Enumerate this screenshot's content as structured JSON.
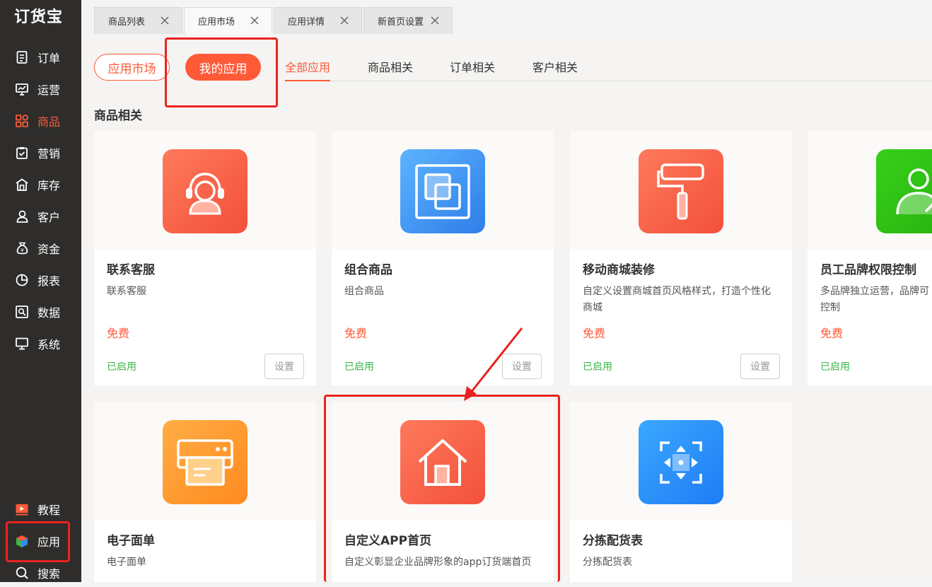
{
  "sidebar": {
    "logo": "订货宝",
    "items": [
      {
        "label": "订单",
        "icon": "order-doc-icon"
      },
      {
        "label": "运营",
        "icon": "chart-board-icon"
      },
      {
        "label": "商品",
        "icon": "grid-squares-icon"
      },
      {
        "label": "营销",
        "icon": "clipboard-check-icon"
      },
      {
        "label": "库存",
        "icon": "warehouse-icon"
      },
      {
        "label": "客户",
        "icon": "user-icon"
      },
      {
        "label": "资金",
        "icon": "money-bag-icon"
      },
      {
        "label": "报表",
        "icon": "pie-chart-icon"
      },
      {
        "label": "数据",
        "icon": "data-search-icon"
      },
      {
        "label": "系统",
        "icon": "monitor-icon"
      }
    ],
    "bottom_items": [
      {
        "label": "教程",
        "icon": "video-play-icon"
      },
      {
        "label": "应用",
        "icon": "cube-icon"
      },
      {
        "label": "搜索",
        "icon": "search-icon"
      }
    ]
  },
  "tabs": [
    {
      "label": "商品列表"
    },
    {
      "label": "应用市场"
    },
    {
      "label": "应用详情"
    },
    {
      "label": "新首页设置"
    }
  ],
  "header": {
    "market_label": "应用市场",
    "my_apps_label": "我的应用"
  },
  "subtabs": [
    "全部应用",
    "商品相关",
    "订单相关",
    "客户相关"
  ],
  "section_title": "商品相关",
  "cards": [
    {
      "name": "联系客服",
      "desc": "联系客服",
      "price": "免费",
      "status": "已启用",
      "button": "设置",
      "icon": "customer-service-icon"
    },
    {
      "name": "组合商品",
      "desc": "组合商品",
      "price": "免费",
      "status": "已启用",
      "button": "设置",
      "icon": "combine-squares-icon"
    },
    {
      "name": "移动商城装修",
      "desc": "自定义设置商城首页风格样式，打造个性化商城",
      "price": "免费",
      "status": "已启用",
      "button": "设置",
      "icon": "paint-roller-icon"
    },
    {
      "name": "员工品牌权限控制",
      "desc": "多品牌独立运营，品牌可控制",
      "price": "免费",
      "status": "已启用",
      "icon": "user-permission-icon"
    },
    {
      "name": "电子面单",
      "desc": "电子面单",
      "icon": "printer-icon"
    },
    {
      "name": "自定义APP首页",
      "desc": "自定义彰显企业品牌形象的app订货端首页",
      "icon": "home-icon"
    },
    {
      "name": "分拣配货表",
      "desc": "分拣配货表",
      "icon": "sort-arrows-icon"
    }
  ],
  "colors": {
    "accent": "#ff5a38",
    "sidebar_bg": "#2f2d2b",
    "enabled_green": "#3cb54a",
    "highlight_red": "#e8231f"
  }
}
